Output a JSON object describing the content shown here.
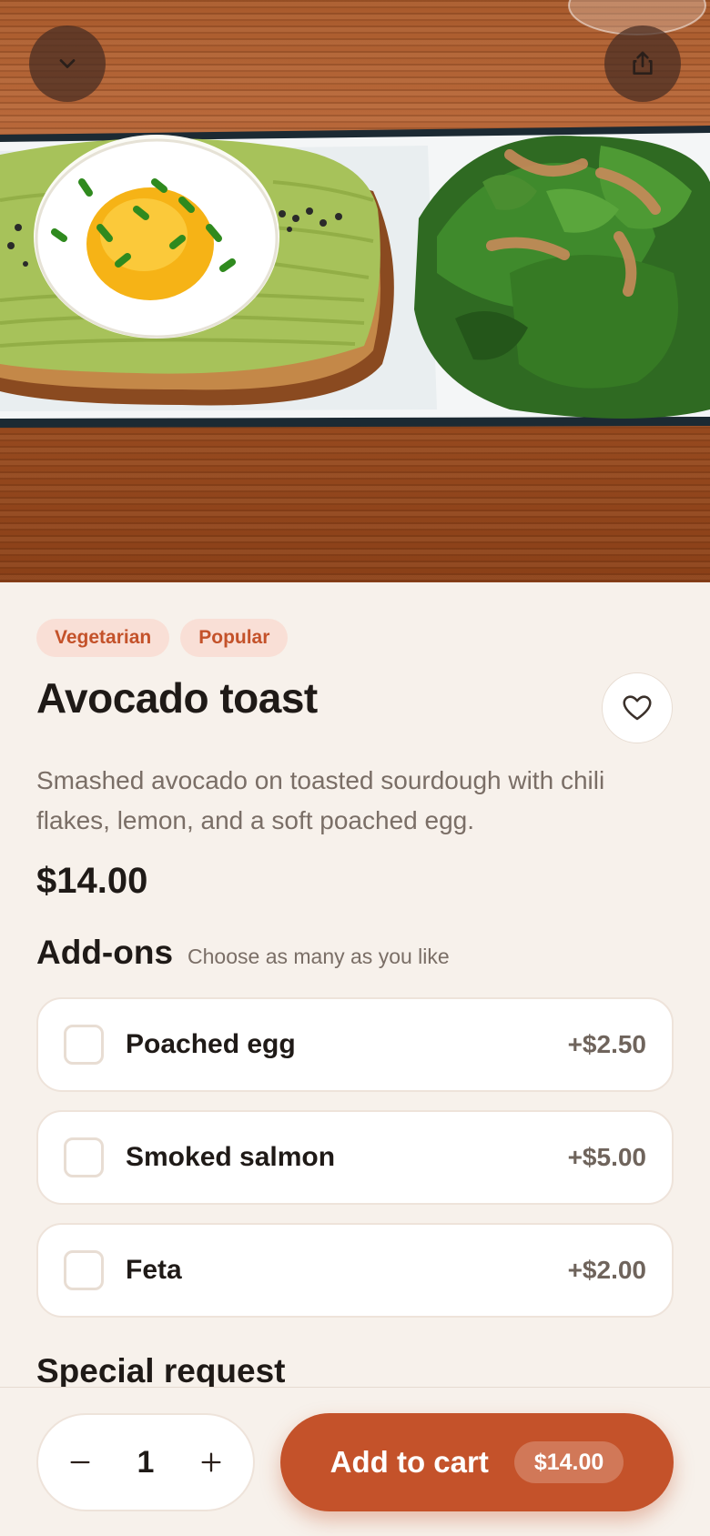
{
  "header": {
    "collapse_icon": "chevron-down-icon",
    "share_icon": "share-icon"
  },
  "product": {
    "tags": [
      "Vegetarian",
      "Popular"
    ],
    "title": "Avocado toast",
    "description": "Smashed avocado on toasted sourdough with chili flakes, lemon, and a soft poached egg.",
    "price": "$14.00",
    "favorite_icon": "heart-icon"
  },
  "addons": {
    "title": "Add-ons",
    "subtitle": "Choose as many as you like",
    "items": [
      {
        "name": "Poached egg",
        "price": "+$2.50",
        "checked": false
      },
      {
        "name": "Smoked salmon",
        "price": "+$5.00",
        "checked": false
      },
      {
        "name": "Feta",
        "price": "+$2.00",
        "checked": false
      }
    ]
  },
  "special_request": {
    "title": "Special request"
  },
  "cart_bar": {
    "quantity": "1",
    "add_label": "Add to cart",
    "total": "$14.00"
  },
  "colors": {
    "accent": "#c4522a",
    "tag_bg": "#f9dfd6",
    "page_bg": "#f7f1eb"
  }
}
